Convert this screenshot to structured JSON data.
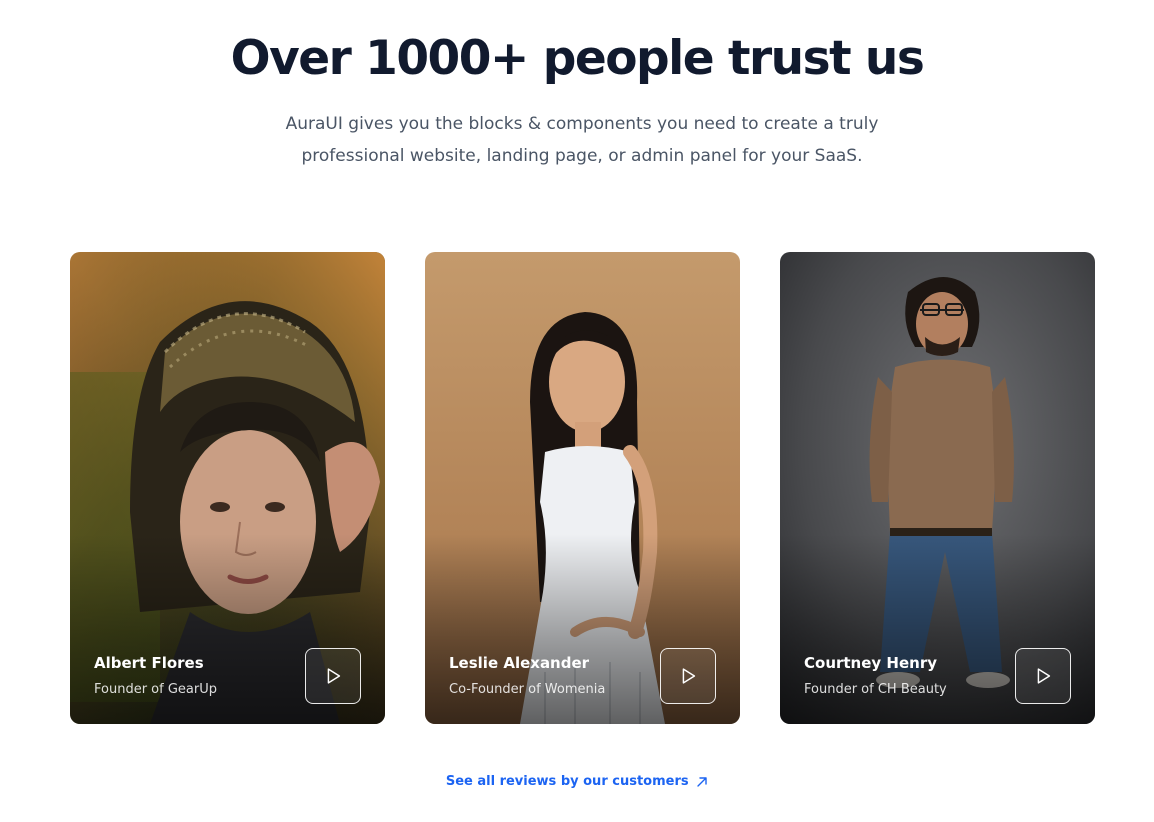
{
  "header": {
    "title": "Over 1000+ people trust us",
    "subtitle_line1": "AuraUI gives you the blocks & components you need to create a truly",
    "subtitle_line2": "professional website, landing page, or admin panel for your SaaS."
  },
  "testimonials": [
    {
      "name": "Albert Flores",
      "role": "Founder of GearUp",
      "photo": "portrait-woman-headscarf"
    },
    {
      "name": "Leslie Alexander",
      "role": "Co-Founder of Womenia",
      "photo": "portrait-woman-white-dress"
    },
    {
      "name": "Courtney Henry",
      "role": "Founder of CH Beauty",
      "photo": "portrait-man-sweater-jeans"
    }
  ],
  "footer": {
    "link_label": "See all reviews by our customers",
    "link_icon": "arrow-up-right-icon"
  },
  "colors": {
    "heading": "#111a2e",
    "body_text": "#4a5565",
    "link": "#1c64f2"
  }
}
